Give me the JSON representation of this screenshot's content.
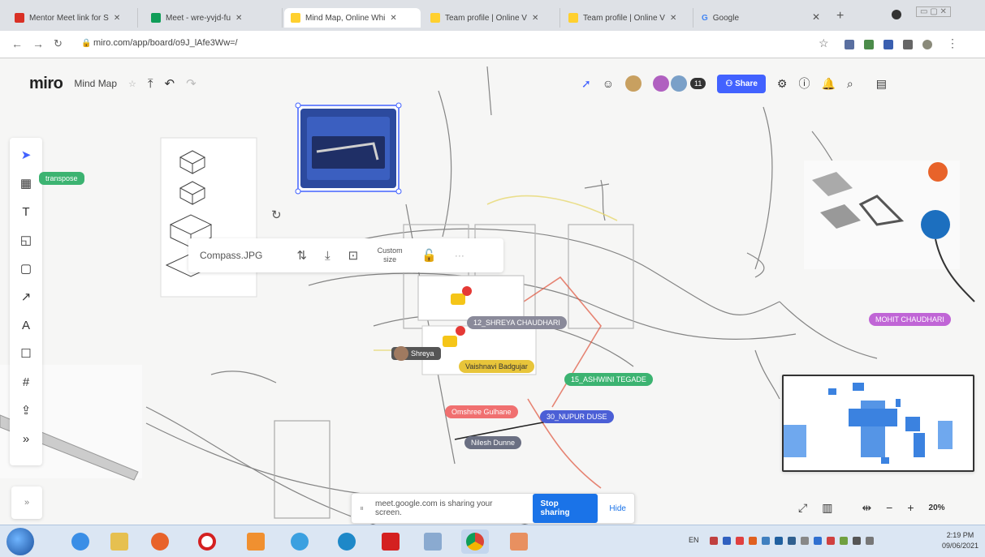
{
  "browser": {
    "tabs": [
      {
        "label": "Mentor Meet link for S",
        "color": "#d93025"
      },
      {
        "label": "Meet - wre-yvjd-fu",
        "color": "#0f9d58"
      },
      {
        "label": "Mind Map, Online Whi",
        "color": "#ffd02f"
      },
      {
        "label": "Team profile | Online V",
        "color": "#ffd02f"
      },
      {
        "label": "Team profile | Online V",
        "color": "#ffd02f"
      },
      {
        "label": "Google",
        "color": "#4285f4"
      }
    ],
    "url": "miro.com/app/board/o9J_lAfe3Ww=/"
  },
  "miro": {
    "logo": "miro",
    "board_name": "Mind Map",
    "avatar_count": "11",
    "share_label": "Share"
  },
  "context_toolbar": {
    "filename": "Compass.JPG",
    "custom_size": "Custom size"
  },
  "stickers": [
    {
      "label": "12_SHREYA CHAUDHARI",
      "color": "#8a8a9a"
    },
    {
      "label": "Shreya",
      "color": "#555555"
    },
    {
      "label": "Vaishnavi Badgujar",
      "color": "#e8c53a"
    },
    {
      "label": "15_ASHWINI TEGADE",
      "color": "#3cb371"
    },
    {
      "label": "Omshree Gulhane",
      "color": "#f07070"
    },
    {
      "label": "30_NUPUR DUSE",
      "color": "#4b5fd6"
    },
    {
      "label": "Nilesh Dunne",
      "color": "#6a6f82"
    },
    {
      "label": "MOHIT CHAUDHARI",
      "color": "#c065d6"
    }
  ],
  "side_label": "transpose",
  "zoom": {
    "level": "20%"
  },
  "share_notice": {
    "text": "meet.google.com is sharing your screen.",
    "stop_label": "Stop sharing",
    "hide_label": "Hide"
  },
  "taskbar": {
    "lang": "EN",
    "time": "2:19 PM",
    "date": "09/06/2021"
  }
}
